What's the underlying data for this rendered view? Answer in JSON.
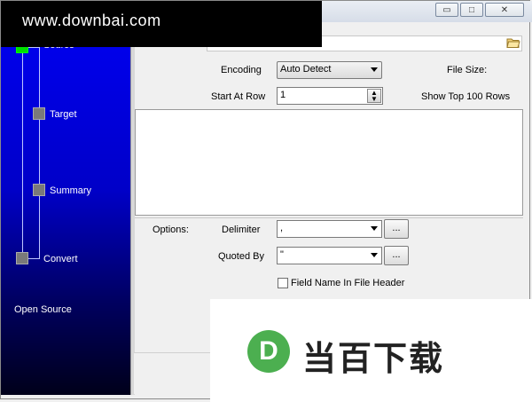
{
  "window": {
    "buttons": {
      "minimize": "▭",
      "maximize": "□",
      "close": "✕"
    }
  },
  "watermark": {
    "url": "www.downbai.com",
    "logo_letter": "D",
    "logo_text": "当百下载"
  },
  "sidebar": {
    "steps": [
      {
        "label": "Source",
        "active": true
      },
      {
        "label": "Target",
        "active": false
      },
      {
        "label": "Summary",
        "active": false
      },
      {
        "label": "Convert",
        "active": false
      }
    ],
    "open_source": "Open Source"
  },
  "form": {
    "encoding_label": "Encoding",
    "encoding_value": "Auto Detect",
    "file_size_label": "File Size:",
    "start_row_label": "Start At Row",
    "start_row_value": "1",
    "show_top_label": "Show Top 100 Rows",
    "options_label": "Options:",
    "delimiter_label": "Delimiter",
    "delimiter_value": ",",
    "quoted_by_label": "Quoted By",
    "quoted_by_value": "\"",
    "browse_label": "...",
    "field_name_header_label": "Field Name In File Header"
  },
  "colors": {
    "sidebar_top": "#0000f0",
    "sidebar_bottom": "#00001a",
    "active_step": "#00e000",
    "logo_green": "#4caf50"
  }
}
